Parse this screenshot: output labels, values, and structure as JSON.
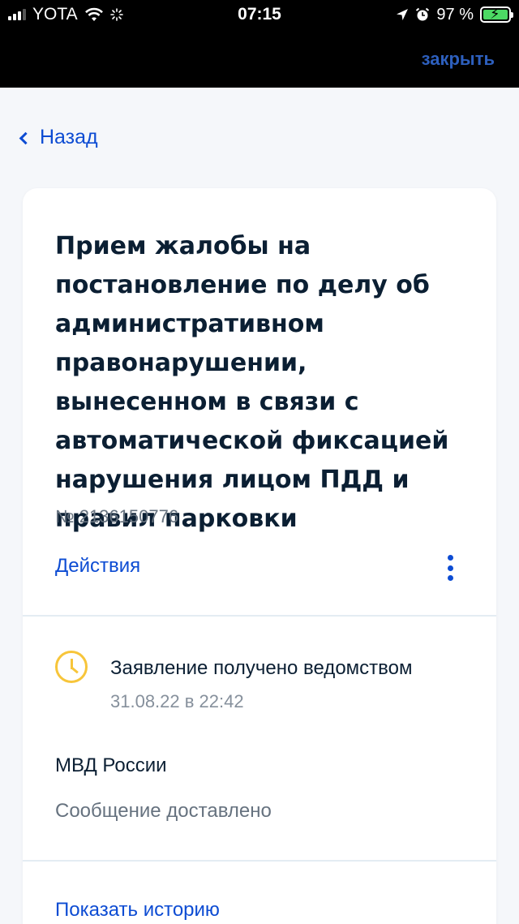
{
  "status_bar": {
    "carrier": "YOTA",
    "time": "07:15",
    "battery": "97 %"
  },
  "top_bar": {
    "close_label": "закрыть"
  },
  "nav": {
    "back_label": "Назад"
  },
  "card": {
    "title": "Прием жалобы на постановление по делу об административном правонарушении, вынесенном в связи с автоматической фиксацией нарушения лицом ПДД и правил парковки",
    "number": "№ 2136150776",
    "actions_label": "Действия",
    "status": {
      "icon": "clock-icon",
      "title": "Заявление получено ведомством",
      "date": "31.08.22 в 22:42"
    },
    "organization": "МВД России",
    "message": "Сообщение доставлено",
    "history_label": "Показать историю"
  },
  "colors": {
    "link": "#0d4cd3",
    "status_accent": "#f7c53a",
    "text_primary": "#0b1f33",
    "text_secondary": "#66727f"
  }
}
